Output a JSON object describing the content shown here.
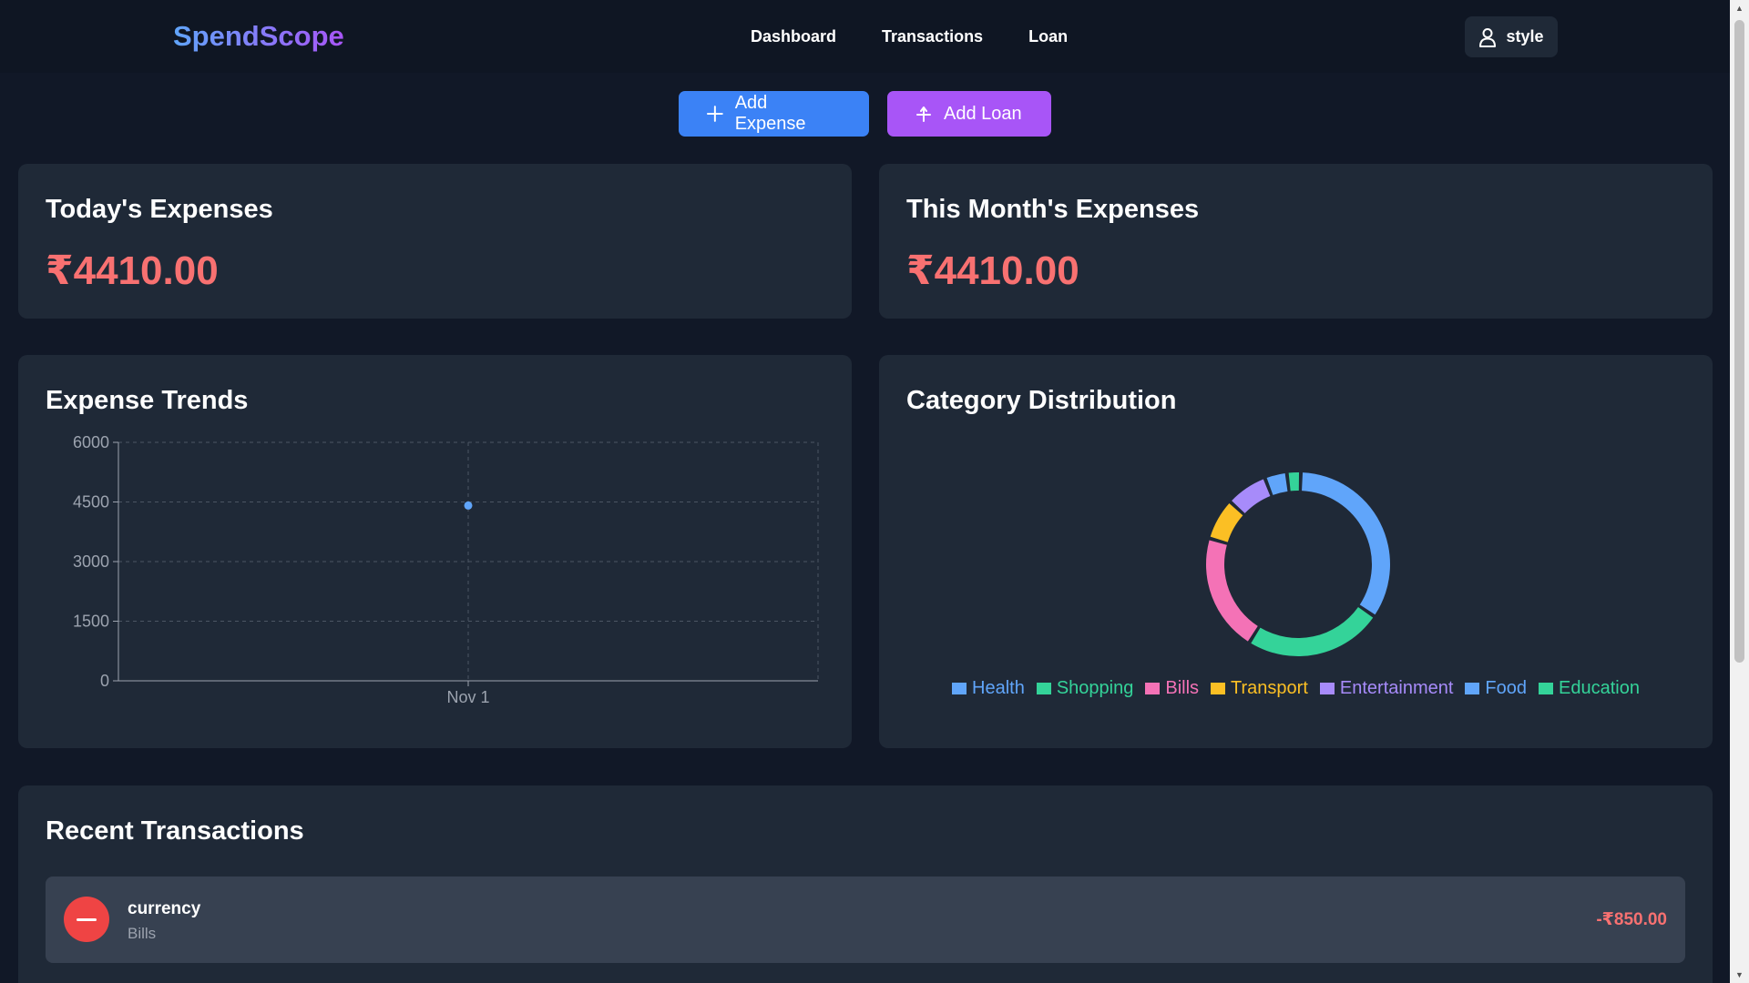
{
  "app": {
    "brand": "SpendScope"
  },
  "nav": {
    "links": [
      "Dashboard",
      "Transactions",
      "Loan"
    ],
    "user_label": "style",
    "user_icon": "user-icon"
  },
  "actions": {
    "add_expense": "Add Expense",
    "add_expense_icon": "plus-icon",
    "add_loan": "Add Loan",
    "add_loan_icon": "loan-icon"
  },
  "summary": {
    "today": {
      "title": "Today's Expenses",
      "amount": "₹4410.00"
    },
    "month": {
      "title": "This Month's Expenses",
      "amount": "₹4410.00"
    }
  },
  "trends": {
    "title": "Expense Trends"
  },
  "category": {
    "title": "Category Distribution"
  },
  "chart_data": [
    {
      "type": "line",
      "title": "Expense Trends",
      "categories": [
        "Nov 1"
      ],
      "values": [
        4410
      ],
      "ylim": [
        0,
        6000
      ],
      "yticks": [
        0,
        1500,
        3000,
        4500,
        6000
      ],
      "grid": true,
      "color": "#60a5fa"
    },
    {
      "type": "pie",
      "title": "Category Distribution",
      "labels": [
        "Health",
        "Shopping",
        "Bills",
        "Transport",
        "Entertainment",
        "Food",
        "Education"
      ],
      "values": [
        1400,
        1000,
        850,
        300,
        300,
        160,
        100
      ],
      "colors": [
        "#60a5fa",
        "#34d399",
        "#f472b6",
        "#fbbf24",
        "#a78bfa",
        "#60a5fa",
        "#34d399"
      ],
      "legend_position": "bottom"
    }
  ],
  "recent": {
    "title": "Recent Transactions",
    "items": [
      {
        "name": "currency",
        "category": "Bills",
        "amount": "-₹850.00",
        "icon": "minus-icon"
      }
    ]
  }
}
